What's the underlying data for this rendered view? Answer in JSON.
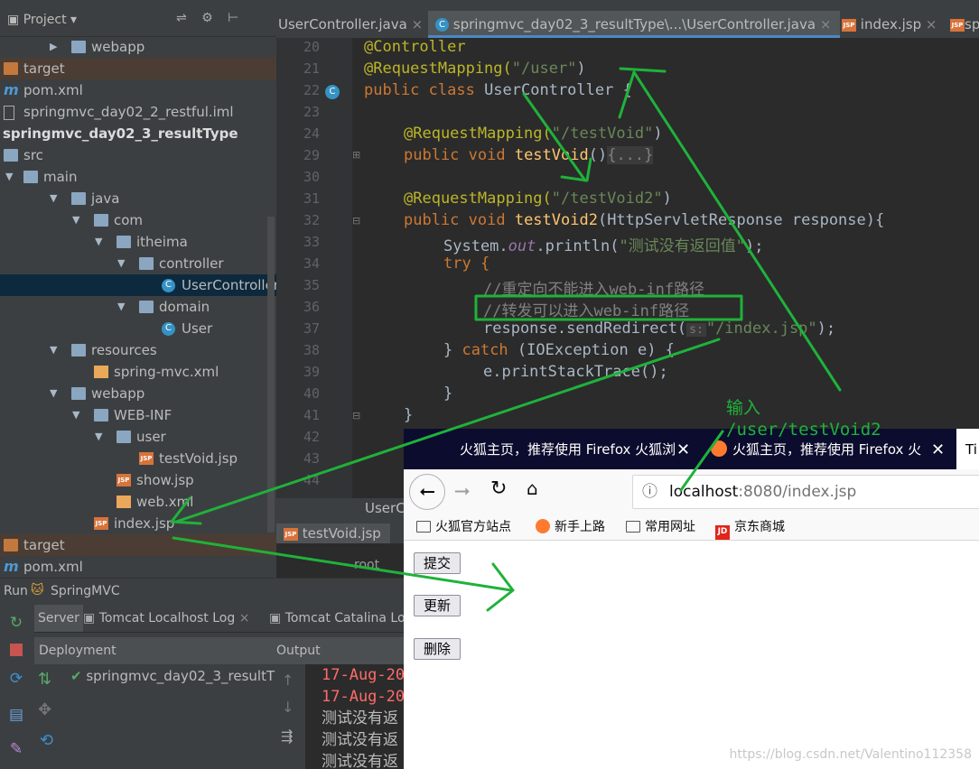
{
  "project": {
    "title": "Project",
    "rows": [
      {
        "label": "webapp",
        "type": "folder",
        "indent": 1,
        "arrow": "right"
      },
      {
        "label": "target",
        "type": "folder-o",
        "indent": 0,
        "arrow": "",
        "hl": true
      },
      {
        "label": "pom.xml",
        "type": "maven",
        "indent": 0,
        "arrow": ""
      },
      {
        "label": "springmvc_day02_2_restful.iml",
        "type": "file",
        "indent": 0,
        "arrow": ""
      },
      {
        "label": "springmvc_day02_3_resultType",
        "type": "bold",
        "indent": 0,
        "arrow": ""
      },
      {
        "label": "src",
        "type": "folder",
        "indent": 0,
        "arrow": ""
      },
      {
        "label": "main",
        "type": "folder",
        "indent": 0,
        "arrow": "down"
      },
      {
        "label": "java",
        "type": "folder",
        "indent": 1,
        "arrow": "down"
      },
      {
        "label": "com",
        "type": "folder",
        "indent": 2,
        "arrow": "down"
      },
      {
        "label": "itheima",
        "type": "folder",
        "indent": 3,
        "arrow": "down"
      },
      {
        "label": "controller",
        "type": "folder",
        "indent": 4,
        "arrow": "down"
      },
      {
        "label": "UserController",
        "type": "class",
        "indent": 5,
        "arrow": "",
        "sel": true
      },
      {
        "label": "domain",
        "type": "folder",
        "indent": 4,
        "arrow": "down"
      },
      {
        "label": "User",
        "type": "class",
        "indent": 5,
        "arrow": ""
      },
      {
        "label": "resources",
        "type": "folder",
        "indent": 1,
        "arrow": "down"
      },
      {
        "label": "spring-mvc.xml",
        "type": "xml",
        "indent": 2,
        "arrow": ""
      },
      {
        "label": "webapp",
        "type": "folder",
        "indent": 1,
        "arrow": "down"
      },
      {
        "label": "WEB-INF",
        "type": "folder",
        "indent": 2,
        "arrow": "down"
      },
      {
        "label": "user",
        "type": "folder",
        "indent": 3,
        "arrow": "down"
      },
      {
        "label": "testVoid.jsp",
        "type": "jsp",
        "indent": 4,
        "arrow": ""
      },
      {
        "label": "show.jsp",
        "type": "jsp",
        "indent": 3,
        "arrow": ""
      },
      {
        "label": "web.xml",
        "type": "xml",
        "indent": 3,
        "arrow": ""
      },
      {
        "label": "index.jsp",
        "type": "jsp",
        "indent": 2,
        "arrow": ""
      },
      {
        "label": "target",
        "type": "folder-o",
        "indent": 0,
        "arrow": "",
        "hl": true
      },
      {
        "label": "pom.xml",
        "type": "maven",
        "indent": 0,
        "arrow": ""
      }
    ]
  },
  "editor_tabs": [
    "UserController.java",
    "springmvc_day02_3_resultType\\...\\UserController.java",
    "index.jsp",
    "sp"
  ],
  "line_numbers": [
    "20",
    "21",
    "22",
    "23",
    "24",
    "29",
    "30",
    "31",
    "32",
    "33",
    "34",
    "35",
    "36",
    "37",
    "38",
    "39",
    "40",
    "41",
    "42",
    "43",
    "44"
  ],
  "code": {
    "l20": "@Controller",
    "l21a": "@RequestMapping(",
    "l21b": "\"/user\"",
    "l21c": ")",
    "l22a": "public class ",
    "l22b": "UserController {",
    "l24a": "@RequestMapping(",
    "l24b": "\"/testVoid\"",
    "l24c": ")",
    "l29a": "public void ",
    "l29b": "testVoid",
    "l29c": "()",
    "l29d": "{...}",
    "l31a": "@RequestMapping(",
    "l31b": "\"/testVoid2\"",
    "l31c": ")",
    "l32a": "public void ",
    "l32b": "testVoid2",
    "l32c": "(HttpServletResponse response){",
    "l33a": "System.",
    "l33b": "out",
    "l33c": ".println(",
    "l33d": "\"测试没有返回值\"",
    "l33e": ");",
    "l34": "try {",
    "l35": "//重定向不能进入web-inf路径",
    "l36": "//转发可以进入web-inf路径",
    "l37a": "response.sendRedirect(",
    "l37hint": "s:",
    "l37b": "\"/index.jsp\"",
    "l37c": ");",
    "l38a": "} ",
    "l38b": "catch ",
    "l38c": "(IOException e) {",
    "l39": "e.printStackTrace();",
    "l40": "}",
    "l41": "}"
  },
  "bottom_tabs": {
    "file": "UserC",
    "jsp": "testVoid.jsp",
    "crumb": "root"
  },
  "run": {
    "label": "Run",
    "config": "SpringMVC",
    "tabs": [
      "Server",
      "Tomcat Localhost Log",
      "Tomcat Catalina Lo"
    ],
    "deployment": "Deployment",
    "output": "Output",
    "artifact": "springmvc_day02_3_resultT",
    "lines": [
      "17-Aug-20",
      "17-Aug-20",
      "测试没有返",
      "测试没有返",
      "测试没有返"
    ]
  },
  "browser": {
    "tabs": [
      "火狐主页，推荐使用 Firefox 火狐浏",
      "火狐主页，推荐使用 Firefox 火",
      "Ti"
    ],
    "url_host": "localhost",
    "url_rest": ":8080/index.jsp",
    "bookmarks": [
      "火狐官方站点",
      "新手上路",
      "常用网址",
      "京东商城"
    ],
    "buttons": [
      "提交",
      "更新",
      "删除"
    ],
    "watermark": "https://blog.csdn.net/Valentino112358"
  },
  "annotation": {
    "line1": "输入",
    "line2": "/user/testVoid2"
  },
  "colors": {
    "annotation": "#1fb23a",
    "editor_bg": "#2b2b2b",
    "selection": "#0d293e"
  }
}
